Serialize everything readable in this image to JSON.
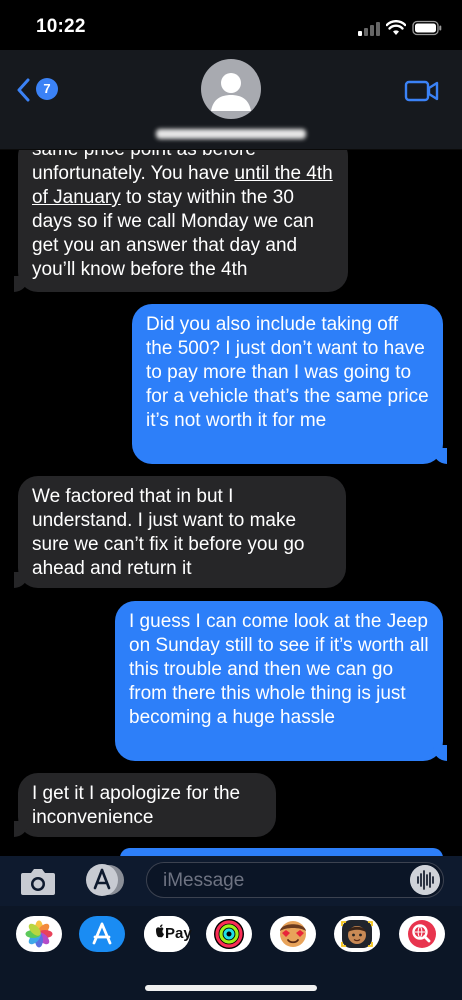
{
  "status_bar": {
    "time": "10:22"
  },
  "header": {
    "back_badge_count": "7",
    "contact_name": "██████████"
  },
  "messages": [
    {
      "direction": "incoming",
      "text_top": "same price point as before unfortunately. You have ",
      "underlined": "until the 4th of January",
      "text_bottom": " to stay within the 30 days so if we call Monday we can get you an answer that day and you’ll know before the 4th"
    },
    {
      "direction": "outgoing",
      "text": "Did you also include taking off the 500? I just don’t want to have to pay more than I was going to for a vehicle that’s the same price it’s not worth it for me"
    },
    {
      "direction": "incoming",
      "text": "We factored that in but I understand. I just want to make sure we can’t fix it before you go ahead and return it"
    },
    {
      "direction": "outgoing",
      "text": "I guess I can come look at the Jeep on Sunday still to see if it’s worth all this trouble and then we can go from there this whole thing is just becoming a huge hassle"
    },
    {
      "direction": "incoming",
      "text": "I get it I apologize for the inconvenience"
    }
  ],
  "composer": {
    "placeholder": "iMessage"
  },
  "app_drawer": {
    "apps": [
      {
        "name": "photos-app-icon"
      },
      {
        "name": "app-store-app-icon"
      },
      {
        "name": "apple-pay-app-icon",
        "label": "Pay"
      },
      {
        "name": "activity-app-icon"
      },
      {
        "name": "memoji-stickers-app-icon"
      },
      {
        "name": "animoji-app-icon"
      },
      {
        "name": "web-search-app-icon"
      }
    ]
  },
  "colors": {
    "outgoing_bubble": "#2d7ff9",
    "incoming_bubble": "#262628",
    "accent": "#3b82f6"
  }
}
